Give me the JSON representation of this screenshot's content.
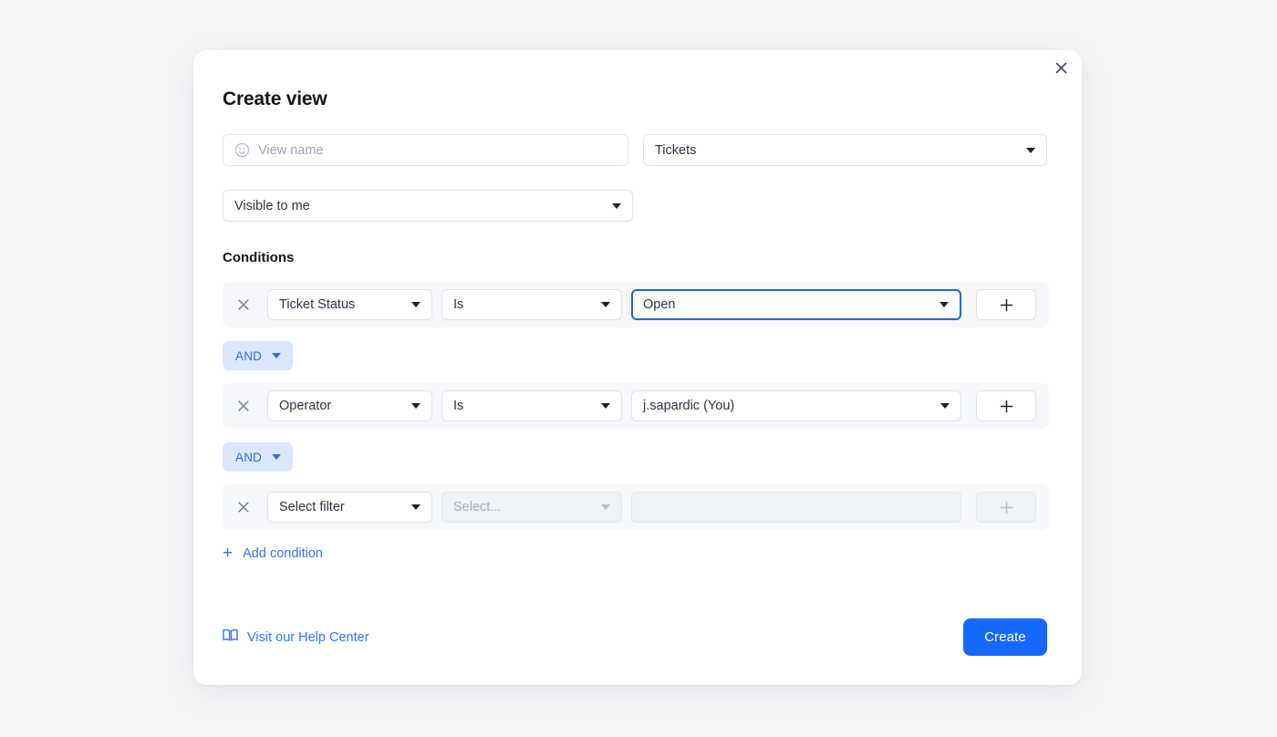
{
  "modal": {
    "title": "Create view",
    "close_icon": "close-icon"
  },
  "form": {
    "view_name": {
      "value": "",
      "placeholder": "View name",
      "icon": "smiley-icon"
    },
    "module": {
      "value": "Tickets",
      "icon": "chevron-down-icon"
    },
    "visibility": {
      "value": "Visible to me",
      "icon": "chevron-down-icon"
    }
  },
  "conditions": {
    "heading": "Conditions",
    "remove_icon": "close-icon",
    "add_row_icon": "plus-icon",
    "rows": [
      {
        "filter": "Ticket Status",
        "operator": "Is",
        "value": "Open",
        "value_focused": true,
        "disabled": false
      },
      {
        "filter": "Operator",
        "operator": "Is",
        "value": "j.sapardic (You)",
        "value_focused": false,
        "disabled": false
      },
      {
        "filter": "Select filter",
        "operator": "Select...",
        "value": "",
        "value_focused": false,
        "disabled": true
      }
    ],
    "joins": [
      {
        "label": "AND",
        "icon": "chevron-down-icon"
      },
      {
        "label": "AND",
        "icon": "chevron-down-icon"
      }
    ],
    "add_condition": {
      "label": "Add condition",
      "icon": "plus-icon"
    }
  },
  "footer": {
    "help_link": {
      "label": "Visit our Help Center",
      "icon": "book-icon"
    },
    "create_button": "Create"
  },
  "colors": {
    "page_background": "#f4f5f7",
    "modal_background": "#ffffff",
    "accent_blue": "#1668ff",
    "link_blue": "#2f76f6",
    "focus_blue": "#1668e3",
    "chip_background": "#dbe7fd",
    "chip_text": "#2f6fe0",
    "row_background": "#f6f8fb",
    "border": "#dfe3ea",
    "text_primary": "#15161a",
    "text_muted": "#9aa5b5"
  }
}
